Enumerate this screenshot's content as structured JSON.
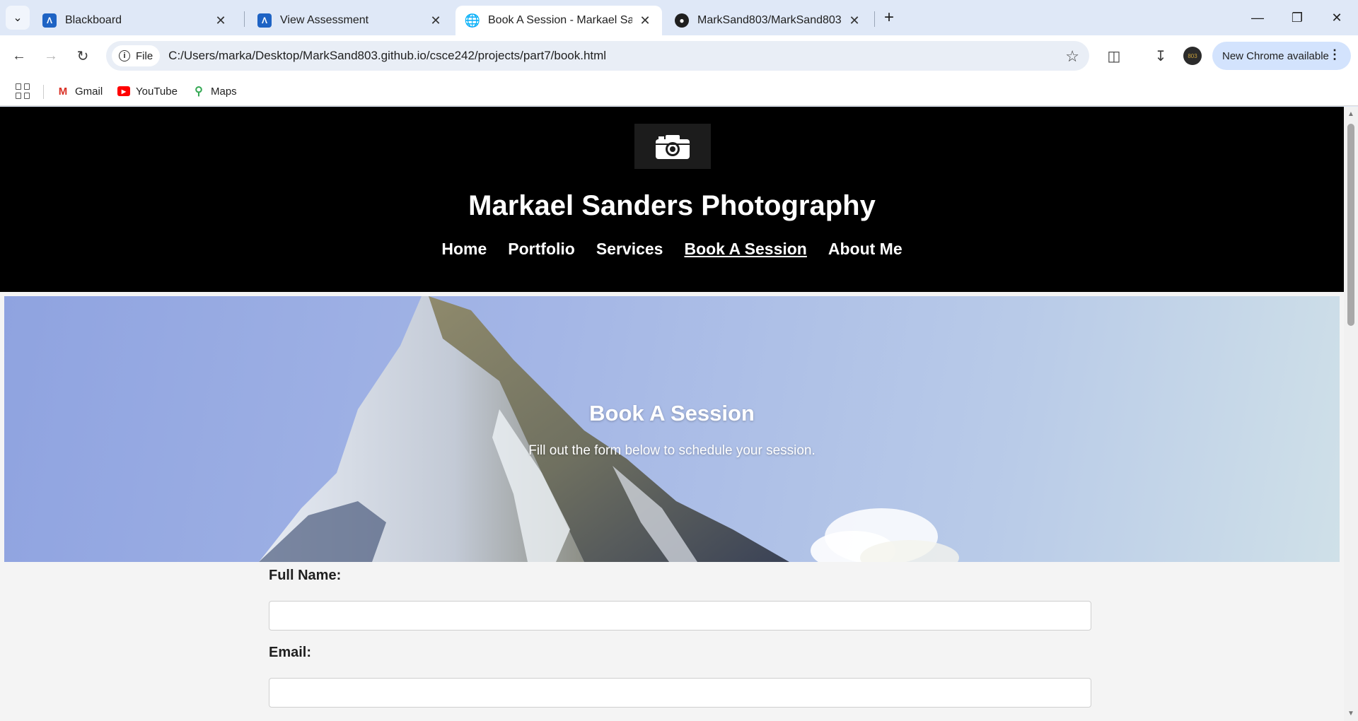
{
  "browser": {
    "tabs": [
      {
        "title": "Blackboard",
        "favicon": "blackboard-icon"
      },
      {
        "title": "View Assessment",
        "favicon": "blackboard-icon"
      },
      {
        "title": "Book A Session - Markael Sanders Photography",
        "favicon": "globe-icon",
        "active": true
      },
      {
        "title": "MarkSand803/MarkSand803.github.io",
        "favicon": "github-icon"
      }
    ],
    "site_chip": "File",
    "url": "C:/Users/marka/Desktop/MarkSand803.github.io/csce242/projects/part7/book.html",
    "update_button": "New Chrome available",
    "profile_initials": "803",
    "bookmarks": [
      {
        "label": "Gmail",
        "icon": "gmail-icon"
      },
      {
        "label": "YouTube",
        "icon": "youtube-icon"
      },
      {
        "label": "Maps",
        "icon": "maps-icon"
      }
    ]
  },
  "page": {
    "site_title": "Markael Sanders Photography",
    "nav": [
      "Home",
      "Portfolio",
      "Services",
      "Book A Session",
      "About Me"
    ],
    "current_nav": "Book A Session",
    "hero": {
      "title": "Book A Session",
      "subtitle": "Fill out the form below to schedule your session."
    },
    "form": {
      "full_name_label": "Full Name:",
      "full_name_value": "",
      "email_label": "Email:",
      "email_value": ""
    }
  },
  "colors": {
    "header_bg": "#000000",
    "page_bg": "#f4f4f4",
    "chrome_frame": "#dfe8f7",
    "update_chip": "#d3e3fd"
  }
}
